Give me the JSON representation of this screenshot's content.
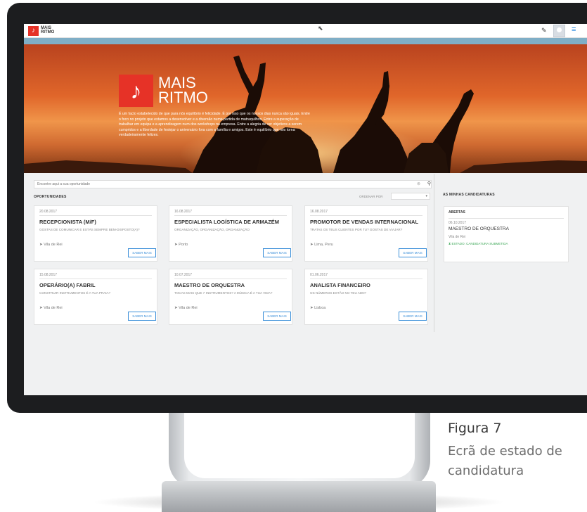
{
  "app": {
    "logo_mark": "♪",
    "logo_text": "MAIS RITMO",
    "menu_icon": "hamburger-icon",
    "edit_icon": "pencil-icon"
  },
  "hero": {
    "logo_mark": "♪",
    "brand": "MAIS RITMO",
    "text": "É um facto estabelecido de que para nós equilíbrio é felicidade. É por isso que os nossos dias nunca são iguais. Entre o foco no projeto que estamos a desenvolver e a diversão numa partida de matraquilhos. Entre a superação de trabalhar em equipa e a aprendizagem num dos workshops na empresa. Entre a alegria de ver objetivos a serem cumpridos e a liberdade de festejar o aniversário fora com a família e amigos. Este é equilíbrio que nos torna verdadeiramente felizes."
  },
  "search": {
    "placeholder": "Encontre aqui a sua oportunidade",
    "clear_icon": "close-icon",
    "button_icon": "search-icon"
  },
  "opportunities": {
    "heading": "OPORTUNIDADES",
    "order_label": "ORDENAR POR",
    "order_value": "",
    "button_label": "SABER MAIS",
    "cards": [
      {
        "date": "20.08.2017",
        "title": "RECEPCIONISTA (M/F)",
        "subtitle": "GOSTAS DE COMUNICAR E ESTÁS SEMPRE BEM-DISPOSTO(A)?",
        "location": "Vila de Rei"
      },
      {
        "date": "16.08.2017",
        "title": "ESPECIALISTA LOGÍSTICA DE ARMAZÉM",
        "subtitle": "ORGANIZAÇÃO, ORGANIZAÇÃO, ORGANIZAÇÃO",
        "location": "Porto"
      },
      {
        "date": "16.08.2017",
        "title": "PROMOTOR DE VENDAS INTERNACIONAL",
        "subtitle": "TRATAS OS TEUS CLIENTES POR TU? GOSTAS DE VIAJAR?",
        "location": "Lima, Peru"
      },
      {
        "date": "15.08.2017",
        "title": "OPERÁRIO(A) FABRIL",
        "subtitle": "CONSTRUIR INSTRUMENTOS É A TUA PRAIA?",
        "location": "Vila de Rei"
      },
      {
        "date": "10.07.2017",
        "title": "MAESTRO DE ORQUESTRA",
        "subtitle": "TOCAS MAIS QUE 7 INSTRUMENTOS? A MÚSICA É A TUA VIDA?",
        "location": "Vila de Rei"
      },
      {
        "date": "01.06.2017",
        "title": "ANALISTA FINANCEIRO",
        "subtitle": "OS NÚMEROS ESTÃO NO TEU ADN?",
        "location": "Lisboa"
      }
    ]
  },
  "applications": {
    "heading": "AS MINHAS CANDIDATURAS",
    "panel_heading": "ABERTAS",
    "item": {
      "date": "06.10.2017",
      "title": "MAESTRO DE ORQUESTRA",
      "location": "Vila de Rei",
      "status": "ESTADO: CANDIDATURA SUBMETIDA"
    }
  },
  "caption": {
    "figure": "Figura 7",
    "text": "Ecrã de estado de candidatura"
  }
}
